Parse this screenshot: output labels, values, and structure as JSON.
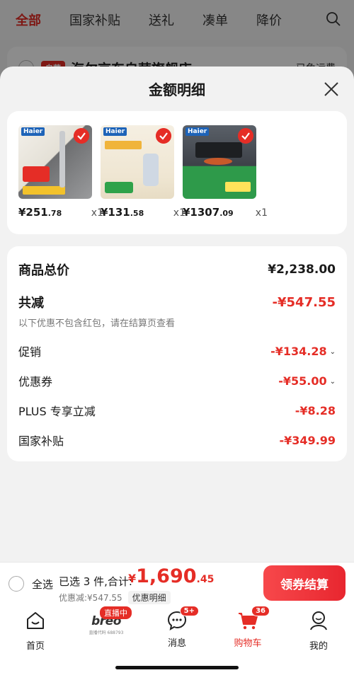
{
  "background": {
    "tabs": [
      "全部",
      "国家补贴",
      "送礼",
      "凑单",
      "降价"
    ],
    "store": {
      "tag": "自营",
      "name": "海尔京东自营旗舰店",
      "shipping": "已免运费"
    }
  },
  "sheet": {
    "title": "金额明细",
    "products": [
      {
        "brand": "Haier",
        "price_int": "¥251",
        "price_dec": ".78",
        "qty": "x1"
      },
      {
        "brand": "Haier",
        "price_int": "¥131",
        "price_dec": ".58",
        "qty": "x1"
      },
      {
        "brand": "Haier",
        "price_int": "¥1307",
        "price_dec": ".09",
        "qty": "x1"
      }
    ],
    "summary": {
      "total_label": "商品总价",
      "total_value": "¥2,238.00",
      "reduce_label": "共减",
      "reduce_value": "-¥547.55",
      "note": "以下优惠不包含红包，请在结算页查看",
      "promo_label": "促销",
      "promo_value": "-¥134.28",
      "coupon_label": "优惠券",
      "coupon_value": "-¥55.00",
      "plus_label": "PLUS 专享立减",
      "plus_value": "-¥8.28",
      "subsidy_label": "国家补贴",
      "subsidy_value": "-¥349.99"
    }
  },
  "checkout": {
    "select_all": "全选",
    "selected_text": "已选 3 件,合计:",
    "currency": "¥",
    "total_int": "1,690",
    "total_dec": ".45",
    "discount_text": "优惠减:¥547.55",
    "detail_label": "优惠明细",
    "button_label": "领券结算"
  },
  "tabbar": {
    "home": "首页",
    "live_badge": "直播中",
    "brand": "breo",
    "brand_sub": "直播代码 688793",
    "messages": "消息",
    "messages_badge": "5+",
    "cart": "购物车",
    "cart_badge": "36",
    "me": "我的"
  },
  "colors": {
    "accent": "#e52d26",
    "button": "#ee3333"
  }
}
